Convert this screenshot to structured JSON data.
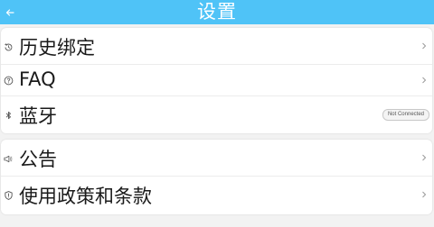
{
  "header": {
    "title": "设置",
    "back_icon": "back-arrow-icon",
    "background": "#4fc3f7"
  },
  "groups": [
    {
      "items": [
        {
          "label": "历史绑定",
          "icon": "history-icon"
        },
        {
          "label": "FAQ",
          "icon": "help-circle-icon"
        },
        {
          "label": "蓝牙",
          "icon": "bluetooth-icon",
          "status": "Not Connected"
        }
      ]
    },
    {
      "items": [
        {
          "label": "公告",
          "icon": "megaphone-icon"
        },
        {
          "label": "使用政策和条款",
          "icon": "shield-icon"
        }
      ]
    }
  ]
}
